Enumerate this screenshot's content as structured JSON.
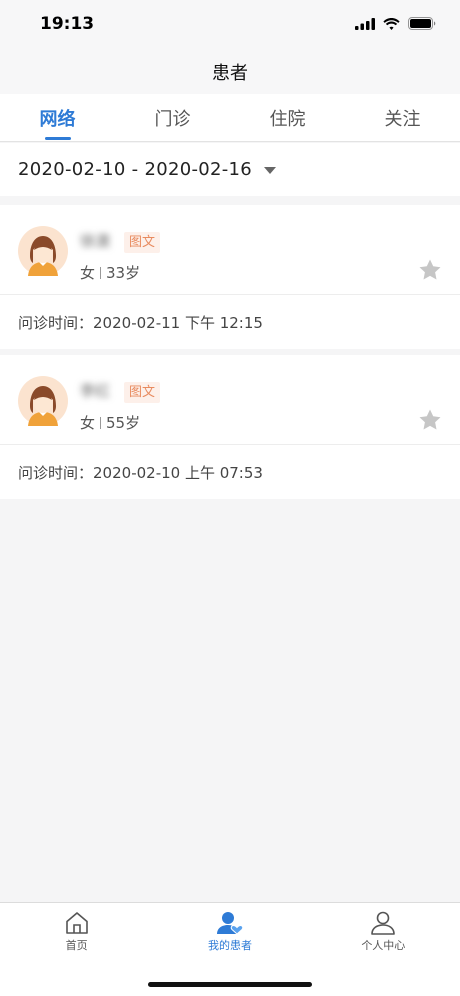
{
  "status_bar": {
    "time": "19:13"
  },
  "nav": {
    "title": "患者"
  },
  "tabs": [
    {
      "label": "网络",
      "active": true
    },
    {
      "label": "门诊",
      "active": false
    },
    {
      "label": "住院",
      "active": false
    },
    {
      "label": "关注",
      "active": false
    }
  ],
  "filter": {
    "date_range": "2020-02-10 - 2020-02-16"
  },
  "patients": [
    {
      "name": "徐澳",
      "tag": "图文",
      "gender": "女",
      "age": "33岁",
      "visit_label": "问诊时间：",
      "visit_time": "2020-02-11 下午 12:15",
      "favorited": false
    },
    {
      "name": "李红",
      "tag": "图文",
      "gender": "女",
      "age": "55岁",
      "visit_label": "问诊时间：",
      "visit_time": "2020-02-10 上午 07:53",
      "favorited": false
    }
  ],
  "bottom_nav": [
    {
      "label": "首页",
      "icon": "home-icon",
      "active": false
    },
    {
      "label": "我的患者",
      "icon": "patients-icon",
      "active": true
    },
    {
      "label": "个人中心",
      "icon": "person-icon",
      "active": false
    }
  ],
  "colors": {
    "accent": "#2e7bd6",
    "tag_text": "#e88a5e",
    "tag_bg": "#fdf0ea"
  }
}
